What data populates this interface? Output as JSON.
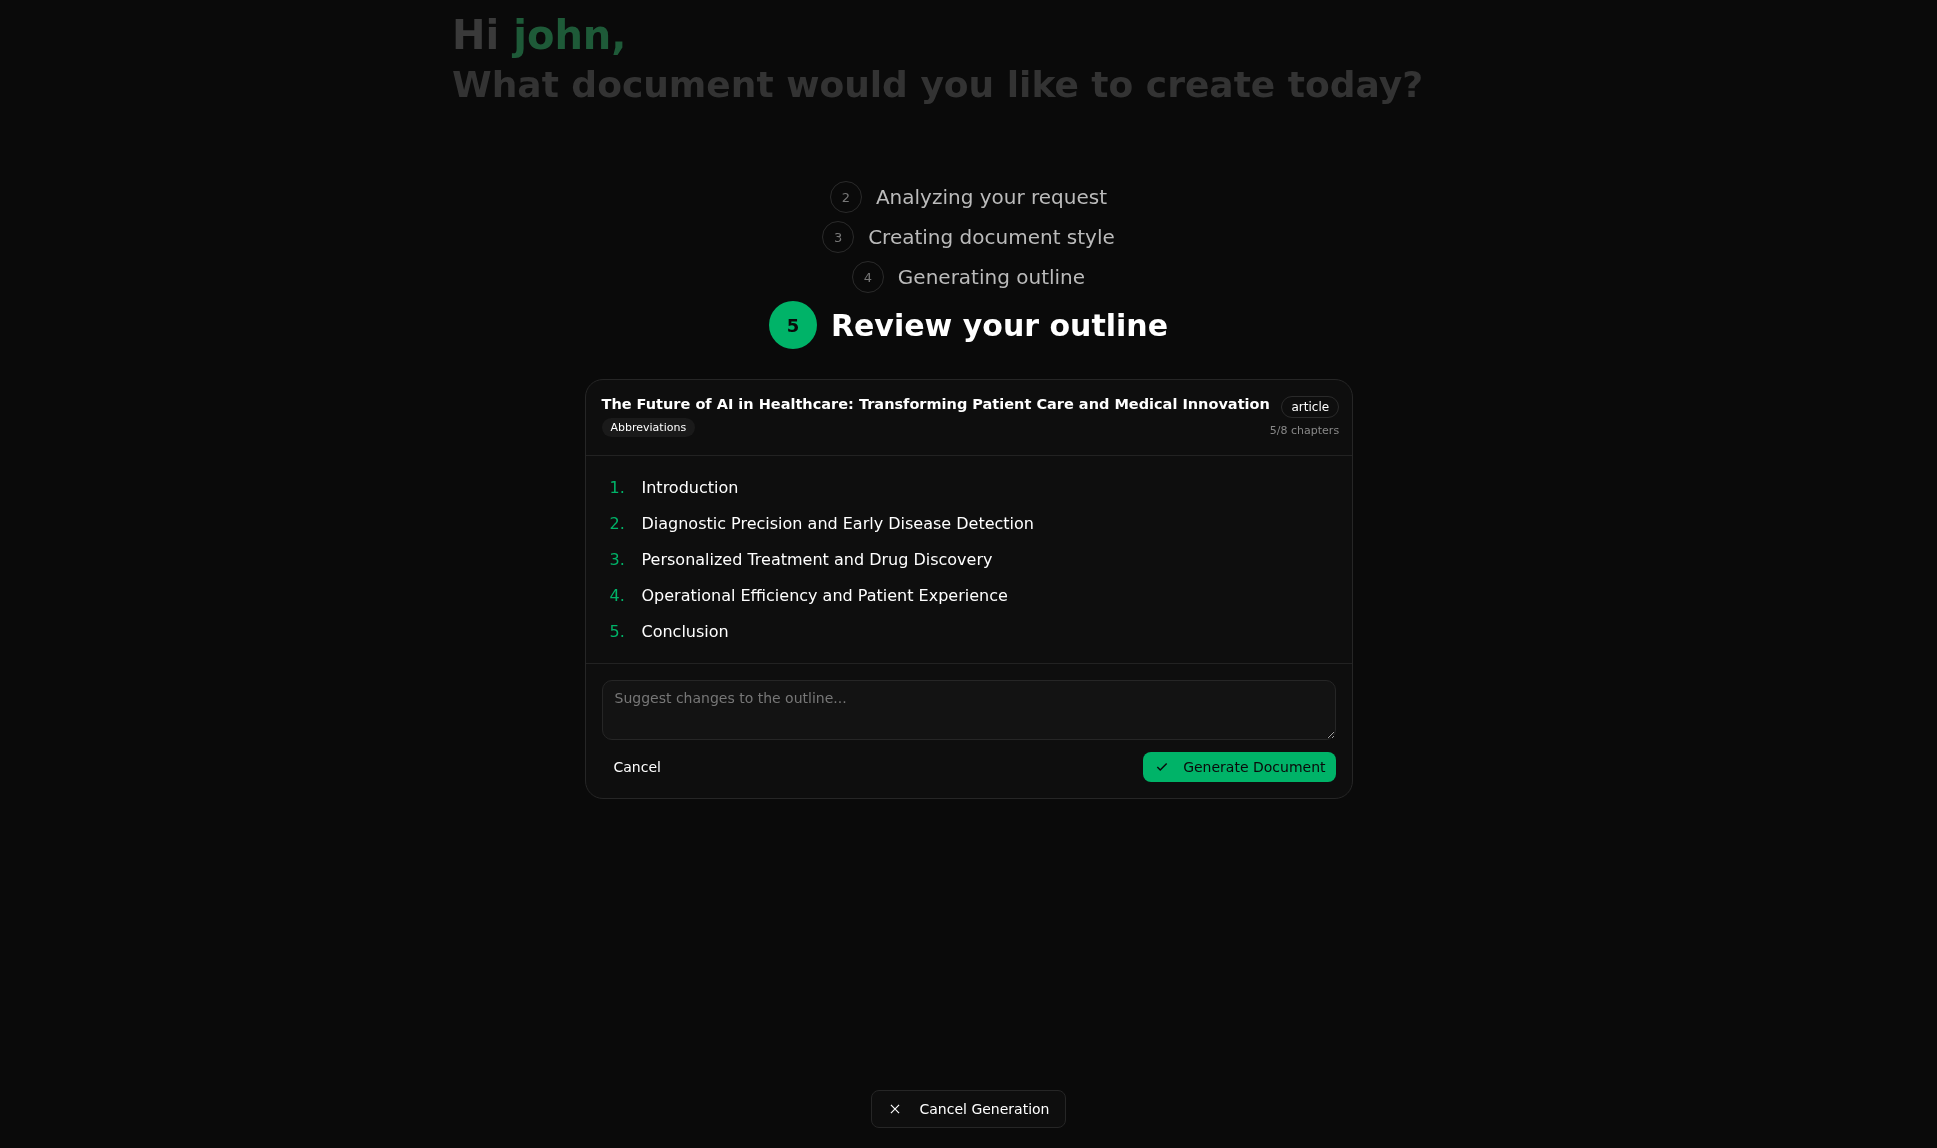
{
  "background": {
    "greeting": "Hi",
    "name": "john,",
    "headline": "What document would you like to create today?"
  },
  "steps": [
    {
      "number": "2",
      "label": "Analyzing your request",
      "selected": false
    },
    {
      "number": "3",
      "label": "Creating document style",
      "selected": false
    },
    {
      "number": "4",
      "label": "Generating outline",
      "selected": false
    },
    {
      "number": "5",
      "label": "Review your outline",
      "selected": true
    }
  ],
  "outline": {
    "title": "The Future of AI in Healthcare: Transforming Patient Care and Medical Innovation",
    "tag": "Abbreviations",
    "type": "article",
    "chapters": "5/8 chapters",
    "items": [
      {
        "number": "1.",
        "label": "Introduction"
      },
      {
        "number": "2.",
        "label": "Diagnostic Precision and Early Disease Detection"
      },
      {
        "number": "3.",
        "label": "Personalized Treatment and Drug Discovery"
      },
      {
        "number": "4.",
        "label": "Operational Efficiency and Patient Experience"
      },
      {
        "number": "5.",
        "label": "Conclusion"
      }
    ],
    "feedback": {
      "placeholder": "Suggest changes to the outline..."
    },
    "cancel": "Cancel",
    "generate": "Generate Document"
  },
  "cancel_generation": "Cancel Generation"
}
